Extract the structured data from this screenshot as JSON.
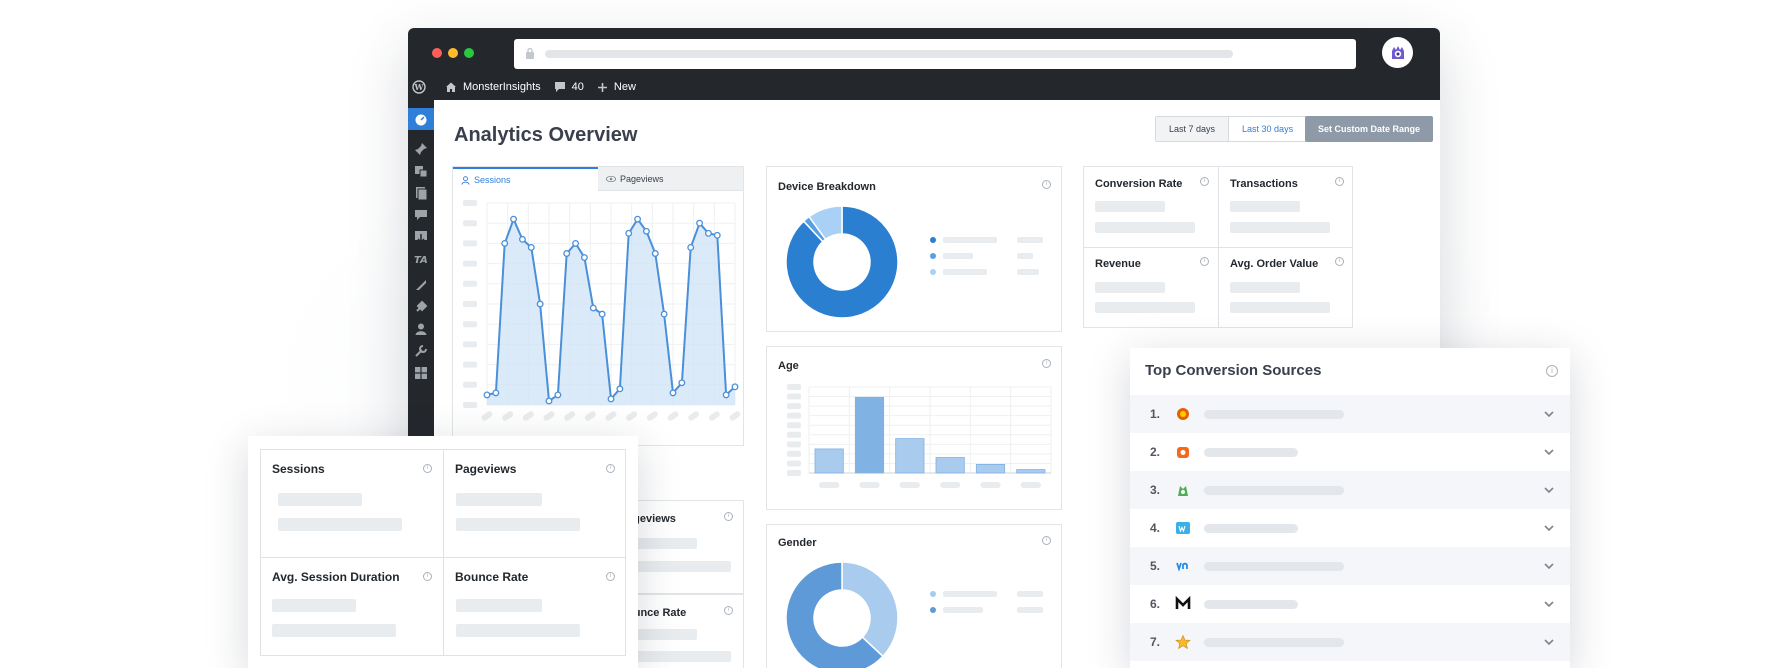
{
  "admin_bar": {
    "site_name": "MonsterInsights",
    "comments_count": "40",
    "new_label": "New"
  },
  "page": {
    "title": "Analytics Overview",
    "range_7": "Last 7 days",
    "range_30": "Last 30 days",
    "custom_range": "Set Custom Date Range"
  },
  "colors": {
    "accent": "#2f7ed8",
    "dark": "#24282d",
    "pie_dark": "#2b7fd0",
    "pie_light": "#a9d0f5"
  },
  "sessions_chart": {
    "tab_sessions": "Sessions",
    "tab_pageviews": "Pageviews"
  },
  "chart_data": [
    {
      "type": "line",
      "values": [
        5,
        6,
        80,
        92,
        82,
        78,
        50,
        2,
        5,
        75,
        80,
        73,
        48,
        45,
        3,
        8,
        85,
        92,
        86,
        75,
        45,
        6,
        11,
        78,
        90,
        85,
        84,
        5,
        9
      ]
    },
    {
      "type": "pie",
      "values": [
        88,
        2,
        10
      ]
    },
    {
      "type": "bar",
      "values": [
        14,
        44,
        20,
        9,
        5,
        2
      ]
    },
    {
      "type": "pie",
      "values": [
        37,
        63
      ]
    }
  ],
  "device_breakdown": {
    "title": "Device Breakdown"
  },
  "age": {
    "title": "Age"
  },
  "gender": {
    "title": "Gender"
  },
  "ecom": {
    "conversion_rate": "Conversion Rate",
    "transactions": "Transactions",
    "revenue": "Revenue",
    "avg_order_value": "Avg. Order Value"
  },
  "behind_panels": {
    "pageviews_partial": "ageviews",
    "bounce_partial": "ounce Rate"
  },
  "stats_card": {
    "sessions": "Sessions",
    "pageviews": "Pageviews",
    "avg_session_duration": "Avg. Session Duration",
    "bounce_rate": "Bounce Rate"
  },
  "top_sources": {
    "title": "Top Conversion Sources",
    "items": [
      {
        "num": "1.",
        "icon": "firefox-icon"
      },
      {
        "num": "2.",
        "icon": "orange-logo-icon"
      },
      {
        "num": "3.",
        "icon": "green-mascot-icon"
      },
      {
        "num": "4.",
        "icon": "wp-icon"
      },
      {
        "num": "5.",
        "icon": "yoast-icon"
      },
      {
        "num": "6.",
        "icon": "medium-icon"
      },
      {
        "num": "7.",
        "icon": "star-icon"
      }
    ]
  }
}
